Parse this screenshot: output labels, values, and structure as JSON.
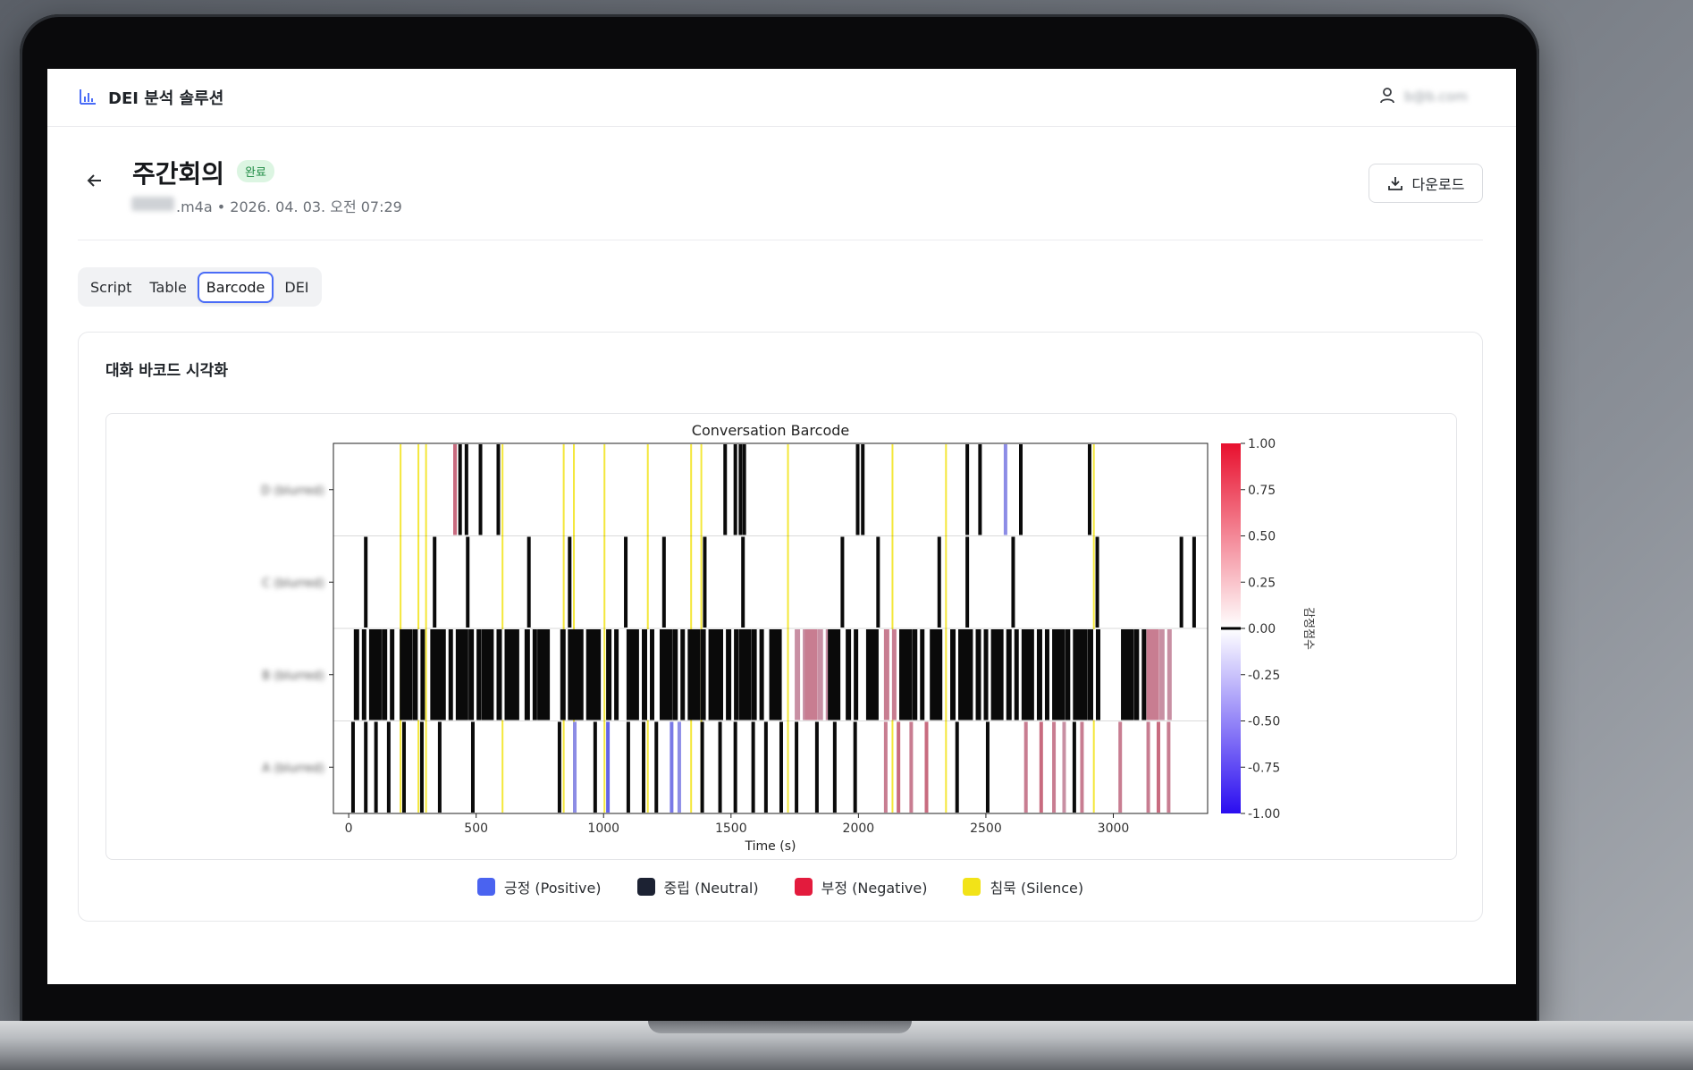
{
  "app": {
    "brand_name": "DEI 분석 솔루션",
    "user_email": "b@b.com"
  },
  "page": {
    "title": "주간회의",
    "status": "완료",
    "meta": ".m4a • 2026. 04. 03. 오전 07:29",
    "download_label": "다운로드"
  },
  "tabs": [
    {
      "label": "Script",
      "active": false
    },
    {
      "label": "Table",
      "active": false
    },
    {
      "label": "Barcode",
      "active": true
    },
    {
      "label": "DEI",
      "active": false
    }
  ],
  "card": {
    "title": "대화 바코드 시각화"
  },
  "legend": [
    {
      "label": "긍정 (Positive)",
      "color": "#4a63f0"
    },
    {
      "label": "중립 (Neutral)",
      "color": "#1c2233"
    },
    {
      "label": "부정 (Negative)",
      "color": "#e31b3d"
    },
    {
      "label": "침묵 (Silence)",
      "color": "#f2e318"
    }
  ],
  "chart_data": {
    "type": "heatmap",
    "title": "Conversation Barcode",
    "xlabel": "Time (s)",
    "ylabel": "",
    "xlim": [
      -60,
      3370
    ],
    "x_ticks": [
      0,
      500,
      1000,
      1500,
      2000,
      2500,
      3000
    ],
    "speakers": [
      "D (blurred)",
      "C (blurred)",
      "B (blurred)",
      "A (blurred)"
    ],
    "colorbar": {
      "label": "감정점수",
      "range": [
        -1.0,
        1.0
      ],
      "ticks": [
        "1.00",
        "0.75",
        "0.50",
        "0.25",
        "0.00",
        "-0.25",
        "-0.50",
        "-0.75",
        "-1.00"
      ]
    },
    "silence_times": [
      200,
      270,
      300,
      600,
      840,
      880,
      1000,
      1170,
      1340,
      1380,
      1720,
      2130,
      2340,
      2920
    ],
    "segments": {
      "D": [
        [
          410,
          0.4
        ],
        [
          430,
          0
        ],
        [
          455,
          0
        ],
        [
          510,
          0
        ],
        [
          580,
          0
        ],
        [
          1470,
          0
        ],
        [
          1510,
          0
        ],
        [
          1530,
          0
        ],
        [
          1545,
          0
        ],
        [
          1990,
          0
        ],
        [
          2010,
          0
        ],
        [
          2420,
          0
        ],
        [
          2470,
          0
        ],
        [
          2570,
          -0.3
        ],
        [
          2630,
          0
        ],
        [
          2900,
          0
        ]
      ],
      "C": [
        [
          60,
          0
        ],
        [
          330,
          0
        ],
        [
          460,
          0
        ],
        [
          700,
          0
        ],
        [
          860,
          0
        ],
        [
          1080,
          0
        ],
        [
          1230,
          0
        ],
        [
          1390,
          0
        ],
        [
          1540,
          0
        ],
        [
          1930,
          0
        ],
        [
          2070,
          0
        ],
        [
          2310,
          0
        ],
        [
          2420,
          0
        ],
        [
          2600,
          0
        ],
        [
          2930,
          0
        ],
        [
          3260,
          0
        ],
        [
          3310,
          0
        ]
      ],
      "B": [
        [
          20,
          0
        ],
        [
          80,
          0
        ],
        [
          130,
          0
        ],
        [
          200,
          0
        ],
        [
          250,
          0
        ],
        [
          320,
          0
        ],
        [
          360,
          0
        ],
        [
          420,
          0
        ],
        [
          470,
          0
        ],
        [
          520,
          0
        ],
        [
          580,
          0
        ],
        [
          620,
          0
        ],
        [
          690,
          0
        ],
        [
          740,
          0
        ],
        [
          830,
          0
        ],
        [
          860,
          0
        ],
        [
          900,
          0
        ],
        [
          940,
          0
        ],
        [
          1010,
          0
        ],
        [
          1090,
          0
        ],
        [
          1150,
          0
        ],
        [
          1220,
          0
        ],
        [
          1270,
          0
        ],
        [
          1330,
          0
        ],
        [
          1380,
          0
        ],
        [
          1420,
          0
        ],
        [
          1480,
          0
        ],
        [
          1530,
          0
        ],
        [
          1580,
          0
        ],
        [
          1650,
          0
        ],
        [
          1750,
          0.2
        ],
        [
          1790,
          0.3
        ],
        [
          1840,
          0.2
        ],
        [
          1880,
          0
        ],
        [
          1950,
          0
        ],
        [
          2030,
          0
        ],
        [
          2100,
          0.3
        ],
        [
          2160,
          0
        ],
        [
          2210,
          0
        ],
        [
          2280,
          0
        ],
        [
          2360,
          0
        ],
        [
          2400,
          0
        ],
        [
          2460,
          0
        ],
        [
          2520,
          0
        ],
        [
          2580,
          0
        ],
        [
          2640,
          0
        ],
        [
          2700,
          0
        ],
        [
          2760,
          0
        ],
        [
          2810,
          0
        ],
        [
          2850,
          0
        ],
        [
          2900,
          0
        ],
        [
          3030,
          0
        ],
        [
          3080,
          0
        ],
        [
          3130,
          0.3
        ],
        [
          3180,
          0.2
        ]
      ],
      "A": [
        [
          10,
          0
        ],
        [
          60,
          0
        ],
        [
          100,
          0
        ],
        [
          150,
          0
        ],
        [
          210,
          0
        ],
        [
          280,
          0
        ],
        [
          350,
          0
        ],
        [
          480,
          0
        ],
        [
          820,
          0
        ],
        [
          880,
          -0.3
        ],
        [
          960,
          0
        ],
        [
          1010,
          -0.5
        ],
        [
          1090,
          0
        ],
        [
          1150,
          0
        ],
        [
          1200,
          0
        ],
        [
          1260,
          -0.4
        ],
        [
          1290,
          -0.3
        ],
        [
          1380,
          0
        ],
        [
          1450,
          0
        ],
        [
          1510,
          0
        ],
        [
          1580,
          0
        ],
        [
          1630,
          0
        ],
        [
          1690,
          0
        ],
        [
          1750,
          0
        ],
        [
          1830,
          0
        ],
        [
          1900,
          0
        ],
        [
          1980,
          0
        ],
        [
          2100,
          0.3
        ],
        [
          2150,
          0.4
        ],
        [
          2200,
          0.3
        ],
        [
          2260,
          0.4
        ],
        [
          2380,
          0
        ],
        [
          2500,
          0
        ],
        [
          2650,
          0.3
        ],
        [
          2710,
          0.4
        ],
        [
          2760,
          0.3
        ],
        [
          2800,
          0.2
        ],
        [
          2840,
          0
        ],
        [
          2870,
          0.3
        ],
        [
          3020,
          0.3
        ],
        [
          3130,
          0.3
        ],
        [
          3170,
          0.4
        ],
        [
          3210,
          0.3
        ]
      ]
    }
  }
}
